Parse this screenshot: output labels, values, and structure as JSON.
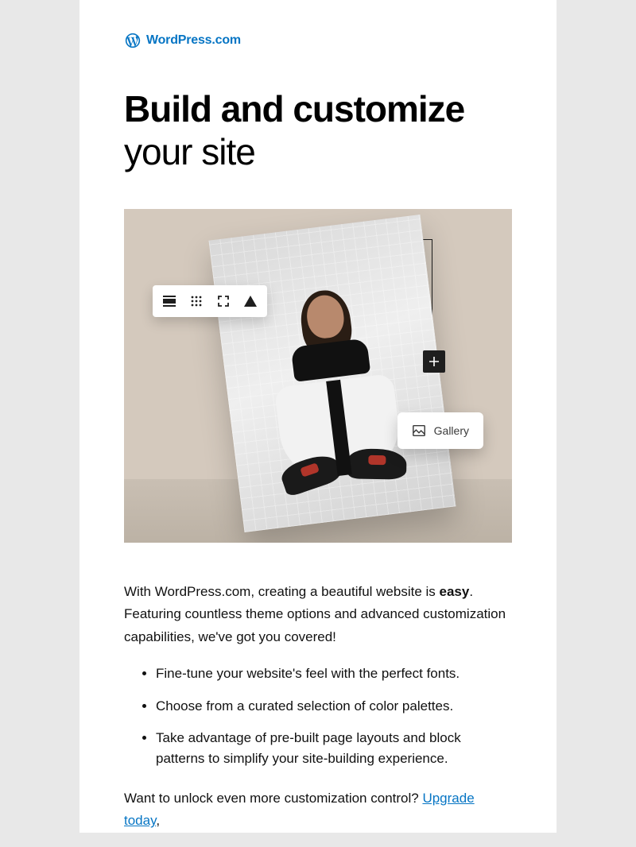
{
  "logo": {
    "text": "WordPress.com"
  },
  "headline": {
    "bold": "Build and customize",
    "light": "your site"
  },
  "hero": {
    "toolbar_icons": [
      "align-icon",
      "grid-dots-icon",
      "fullscreen-icon",
      "contrast-icon"
    ],
    "plus": "+",
    "gallery_label": "Gallery"
  },
  "intro": {
    "pre": "With WordPress.com, creating a beautiful website is ",
    "bold": "easy",
    "post": ". Featuring countless theme options and advanced customization capabilities, we've got you covered!"
  },
  "features": [
    "Fine-tune your website's feel with the perfect fonts.",
    "Choose from a curated selection of color palettes.",
    "Take advantage of pre-built page layouts and block patterns to simplify your site-building experience."
  ],
  "cta": {
    "pre": "Want to unlock even more customization control? ",
    "link": "Upgrade today",
    "post": ","
  }
}
